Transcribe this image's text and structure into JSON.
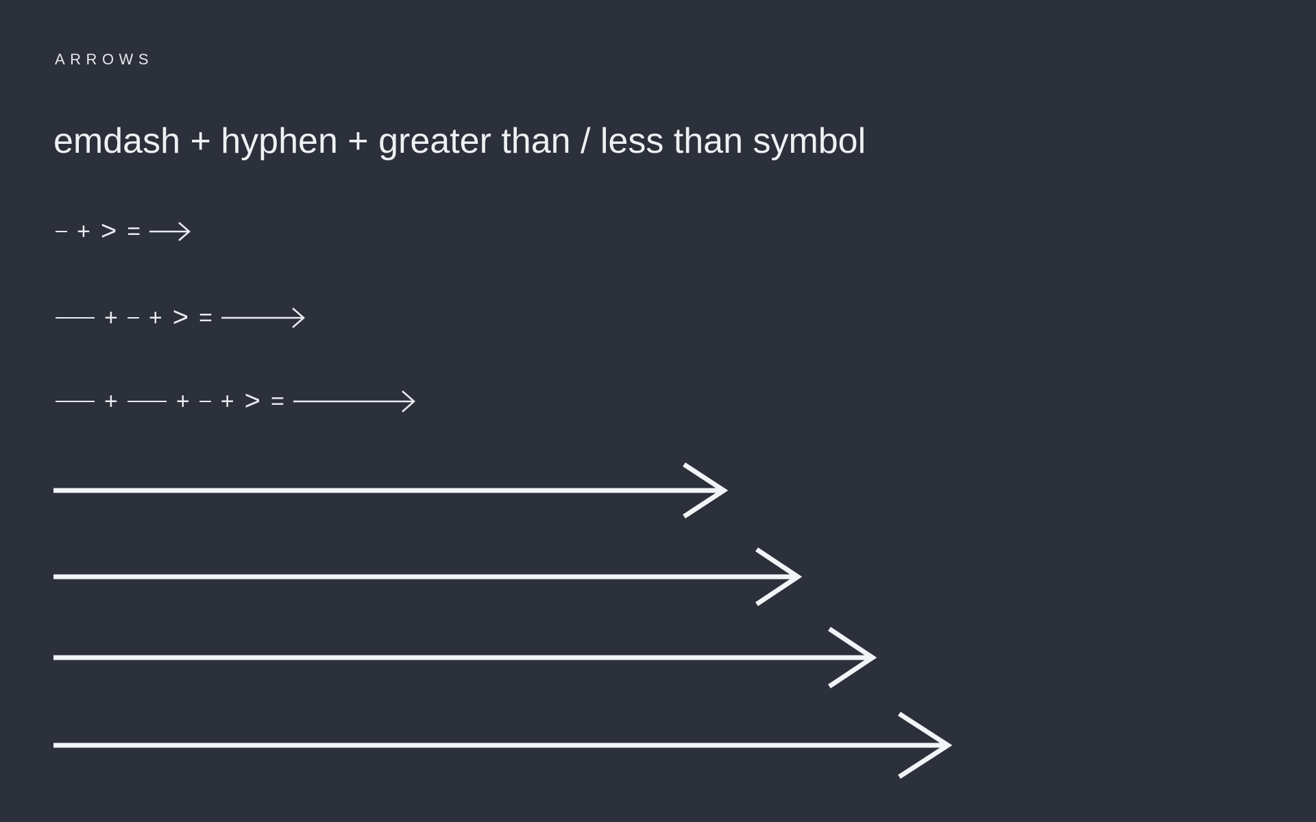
{
  "theme": {
    "background": "#2b303a",
    "foreground": "#e9ecf0",
    "heading_color": "#eef0f3"
  },
  "section": {
    "eyebrow": "ARROWS",
    "heading": "emdash + hyphen + greater than / less than symbol"
  },
  "ligature_rows": [
    {
      "id": "row-hyphen-gt",
      "tokens": [
        "-",
        "+",
        ">",
        "="
      ],
      "plus": "+",
      "equals": "=",
      "hyphen": "-",
      "emdash": "—",
      "greater_than": ">",
      "result_arrow": "→",
      "result_label": "right arrow (short)",
      "arrow_shaft_length": 44,
      "arrow_head_size": 13
    },
    {
      "id": "row-emdash-hyphen-gt",
      "tokens": [
        "—",
        "+",
        "-",
        "+",
        ">",
        "="
      ],
      "plus": "+",
      "equals": "=",
      "hyphen": "-",
      "emdash": "—",
      "greater_than": ">",
      "result_arrow": "⟶",
      "result_label": "long right arrow",
      "arrow_shaft_length": 108,
      "arrow_head_size": 15
    },
    {
      "id": "row-emdash-emdash-hyphen-gt",
      "tokens": [
        "—",
        "+",
        "—",
        "+",
        "-",
        "+",
        ">",
        "="
      ],
      "plus": "+",
      "equals": "=",
      "hyphen": "-",
      "emdash": "—",
      "greater_than": ">",
      "result_arrow": "⟶",
      "result_label": "extra long right arrow",
      "arrow_shaft_length": 168,
      "arrow_head_size": 17
    }
  ],
  "big_arrows": [
    {
      "id": "big-arrow-1",
      "label": "arrow length 1",
      "shaft_length": 970,
      "head_length": 58,
      "head_half_height": 38,
      "stroke_width": 7
    },
    {
      "id": "big-arrow-2",
      "label": "arrow length 2",
      "shaft_length": 1080,
      "head_length": 62,
      "head_half_height": 40,
      "stroke_width": 7
    },
    {
      "id": "big-arrow-3",
      "label": "arrow length 3",
      "shaft_length": 1190,
      "head_length": 66,
      "head_half_height": 42,
      "stroke_width": 7
    },
    {
      "id": "big-arrow-4",
      "label": "arrow length 4",
      "shaft_length": 1300,
      "head_length": 72,
      "head_half_height": 46,
      "stroke_width": 7
    }
  ]
}
